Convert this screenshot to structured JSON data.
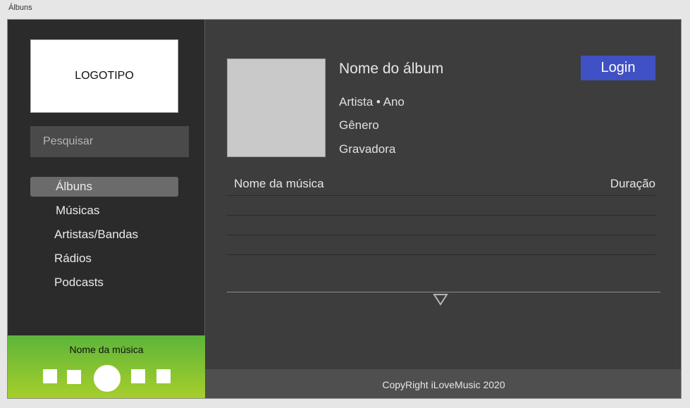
{
  "page": {
    "label": "Álbuns"
  },
  "sidebar": {
    "logo_text": "LOGOTIPO",
    "search": {
      "placeholder": "Pesquisar",
      "value": ""
    },
    "nav": [
      {
        "label": "Álbuns",
        "active": true
      },
      {
        "label": "Músicas",
        "active": false
      },
      {
        "label": "Artistas/Bandas",
        "active": false
      },
      {
        "label": "Rádios",
        "active": false
      },
      {
        "label": "Podcasts",
        "active": false
      }
    ]
  },
  "player": {
    "track_title": "Nome da música",
    "colors": {
      "gradient_top": "#5db53a",
      "gradient_bottom": "#a8cf2a"
    }
  },
  "album": {
    "title": "Nome do álbum",
    "artist_year": "Artista • Ano",
    "genre": "Gênero",
    "label": "Gravadora"
  },
  "header": {
    "login_label": "Login",
    "login_color": "#3f51c4"
  },
  "tracklist": {
    "col_name": "Nome da música",
    "col_duration": "Duração",
    "rows": [
      {},
      {},
      {}
    ]
  },
  "icons": {
    "expand": "triangle-down-icon"
  },
  "footer": {
    "copyright": "CopyRight iLoveMusic 2020"
  }
}
